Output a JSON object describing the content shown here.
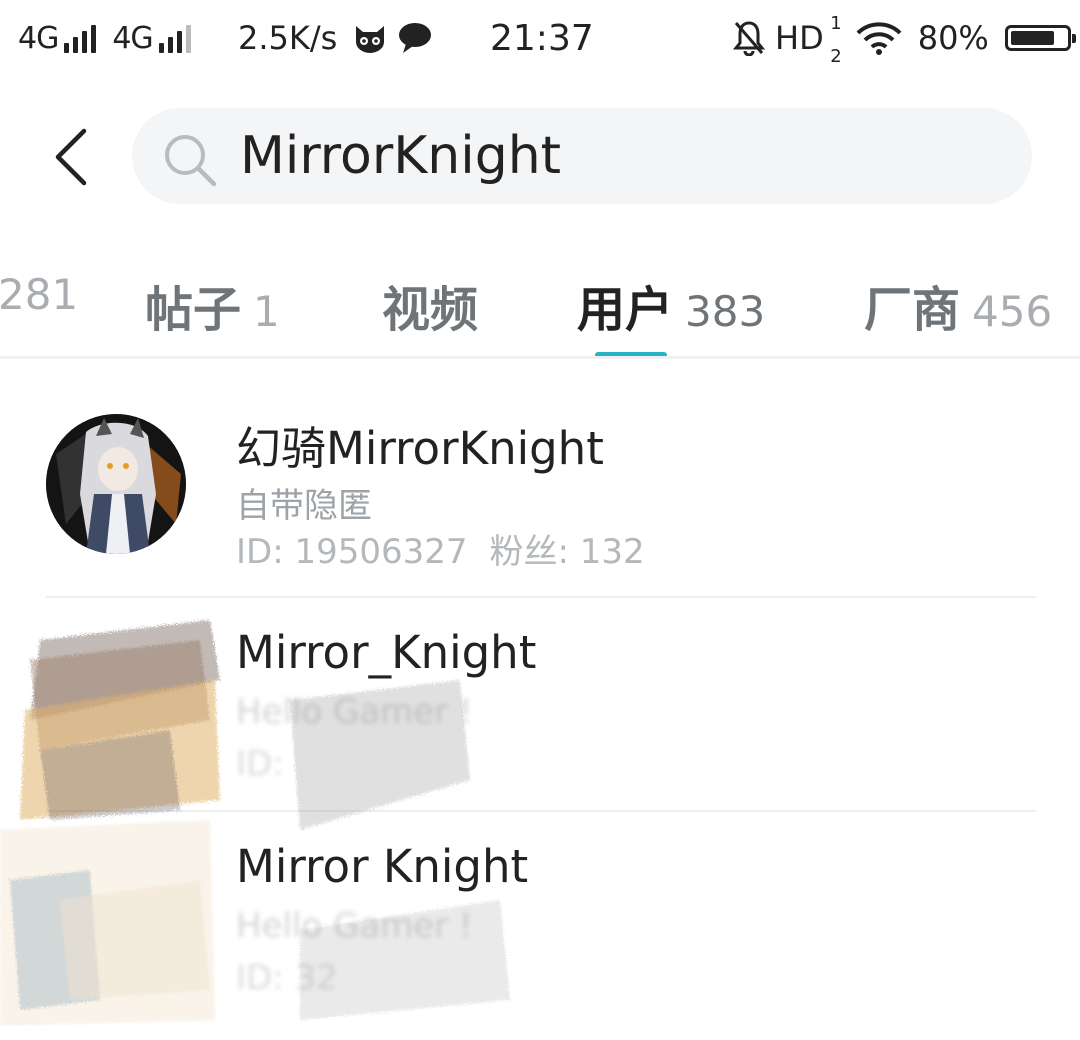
{
  "status_bar": {
    "network1": "4G",
    "network2": "4G",
    "speed": "2.5K/s",
    "time": "21:37",
    "hd_label": "HD",
    "hd_sup": "1",
    "hd_sub": "2",
    "battery_percent": "80%",
    "battery_level": 0.8,
    "icons": [
      "signal-icon",
      "cat-app-icon",
      "chat-bubble-icon",
      "bell-off-icon",
      "wifi-icon",
      "battery-icon"
    ]
  },
  "search": {
    "query": "MirrorKnight"
  },
  "tabs": [
    {
      "label": "",
      "count": "281",
      "active": false
    },
    {
      "label": "帖子",
      "count": "1",
      "active": false
    },
    {
      "label": "视频",
      "count": "",
      "active": false
    },
    {
      "label": "用户",
      "count": "383",
      "active": true
    },
    {
      "label": "厂商",
      "count": "456",
      "active": false
    }
  ],
  "users": [
    {
      "name": "幻骑MirrorKnight",
      "bio": "自带隐匿",
      "id_text": "ID: 19506327",
      "fans_text": "粉丝: 132"
    },
    {
      "name": "Mirror_Knight",
      "bio": "Hello Gamer !",
      "id_text": "ID: "
    },
    {
      "name": "Mirror Knight",
      "bio": "Hello Gamer !",
      "id_text": "ID: 32"
    }
  ],
  "colors": {
    "accent": "#27b3c4",
    "search_bg": "#f3f5f7",
    "muted_text": "#9ea3a7"
  }
}
